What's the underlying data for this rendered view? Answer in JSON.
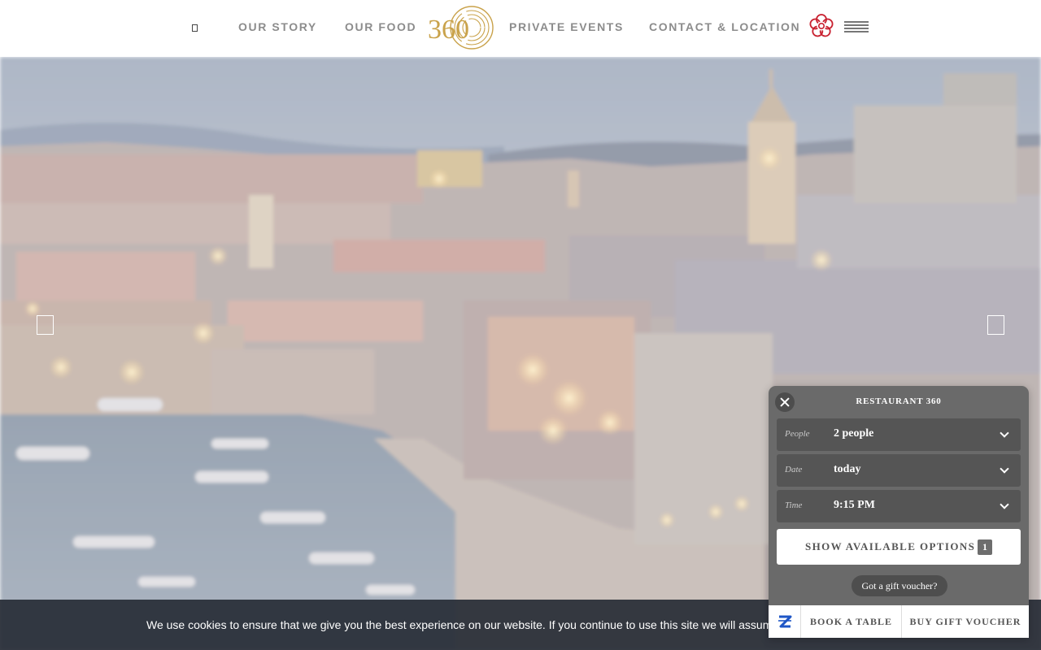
{
  "header": {
    "nav_left": [
      "OUR STORY",
      "OUR FOOD"
    ],
    "logo_text": "360",
    "nav_right": [
      "PRIVATE EVENTS",
      "CONTACT & LOCATION"
    ],
    "icons": {
      "language": "language-icon",
      "michelin": "michelin-flower-icon",
      "menu": "hamburger-menu-icon"
    },
    "colors": {
      "logo_gold": "#c9a24a",
      "michelin_red": "#c8202f",
      "nav_text": "#8c8c8c"
    }
  },
  "hero": {
    "image": "Dubrovnik old town harbour at dusk",
    "prev_icon": "prev-arrow-icon",
    "next_icon": "next-arrow-icon"
  },
  "booking_widget": {
    "title": "RESTAURANT 360",
    "fields": [
      {
        "label": "People",
        "value": "2 people"
      },
      {
        "label": "Date",
        "value": "today"
      },
      {
        "label": "Time",
        "value": "9:15 PM"
      }
    ],
    "show_button": "SHOW AVAILABLE OPTIONS",
    "show_count": "1",
    "gift_voucher_link": "Got a gift voucher?",
    "footer": {
      "logo_icon": "zenchef-z-icon",
      "book_label": "BOOK A TABLE",
      "voucher_label": "BUY GIFT VOUCHER"
    }
  },
  "cookie_bar": {
    "text": "We use cookies to ensure that we give you the best experience on our website. If you continue to use this site we will assume that you are happy with it."
  }
}
